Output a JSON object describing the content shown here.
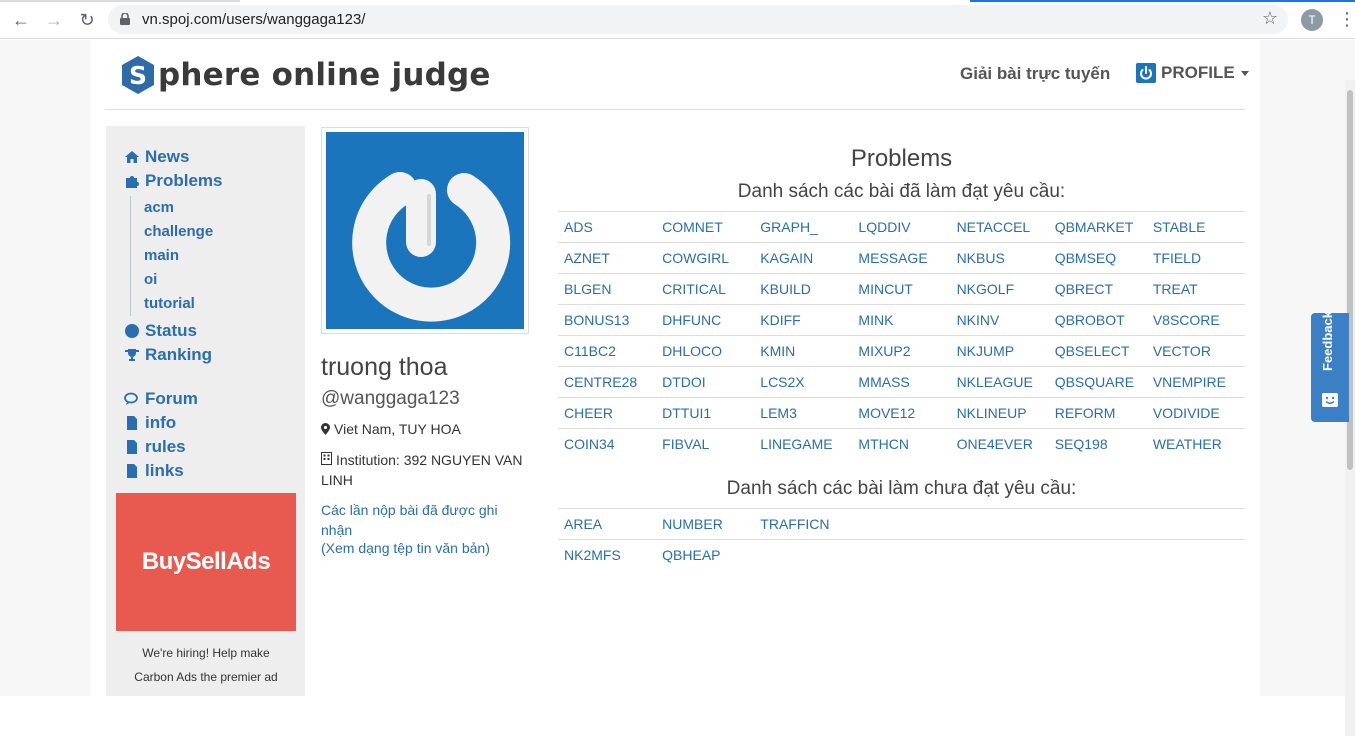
{
  "browser": {
    "url": "vn.spoj.com/users/wanggaga123/",
    "avatar_letter": "T"
  },
  "header": {
    "logo_text": "phere online judge",
    "link": "Giải bài trực tuyến",
    "profile": "PROFILE"
  },
  "sidebar": {
    "news": "News",
    "problems": "Problems",
    "sub": [
      "acm",
      "challenge",
      "main",
      "oi",
      "tutorial"
    ],
    "status": "Status",
    "ranking": "Ranking",
    "forum": "Forum",
    "info": "info",
    "rules": "rules",
    "links": "links",
    "ad_text": "BuySellAds",
    "ad_caption_1": "We're hiring! Help make",
    "ad_caption_2": "Carbon Ads the premier ad"
  },
  "profile": {
    "name": "truong thoa",
    "handle": "@wanggaga123",
    "location": "Viet Nam, TUY HOA",
    "institution": "Institution: 392 NGUYEN VAN LINH",
    "submissions_link": "Các lần nộp bài đã được ghi nhận",
    "text_link": "(Xem dạng tệp tin văn bản)"
  },
  "problems": {
    "title": "Problems",
    "solved_heading": "Danh sách các bài đã làm đạt yêu cầu:",
    "solved": [
      [
        "ADS",
        "COMNET",
        "GRAPH_",
        "LQDDIV",
        "NETACCEL",
        "QBMARKET",
        "STABLE"
      ],
      [
        "AZNET",
        "COWGIRL",
        "KAGAIN",
        "MESSAGE",
        "NKBUS",
        "QBMSEQ",
        "TFIELD"
      ],
      [
        "BLGEN",
        "CRITICAL",
        "KBUILD",
        "MINCUT",
        "NKGOLF",
        "QBRECT",
        "TREAT"
      ],
      [
        "BONUS13",
        "DHFUNC",
        "KDIFF",
        "MINK",
        "NKINV",
        "QBROBOT",
        "V8SCORE"
      ],
      [
        "C11BC2",
        "DHLOCO",
        "KMIN",
        "MIXUP2",
        "NKJUMP",
        "QBSELECT",
        "VECTOR"
      ],
      [
        "CENTRE28",
        "DTDOI",
        "LCS2X",
        "MMASS",
        "NKLEAGUE",
        "QBSQUARE",
        "VNEMPIRE"
      ],
      [
        "CHEER",
        "DTTUI1",
        "LEM3",
        "MOVE12",
        "NKLINEUP",
        "REFORM",
        "VODIVIDE"
      ],
      [
        "COIN34",
        "FIBVAL",
        "LINEGAME",
        "MTHCN",
        "ONE4EVER",
        "SEQ198",
        "WEATHER"
      ]
    ],
    "unsolved_heading": "Danh sách các bài làm chưa đạt yêu cầu:",
    "unsolved": [
      [
        "AREA",
        "NUMBER",
        "TRAFFICN",
        "",
        "",
        "",
        ""
      ],
      [
        "NK2MFS",
        "QBHEAP",
        "",
        "",
        "",
        "",
        ""
      ]
    ]
  },
  "feedback": {
    "label": "Feedback"
  },
  "colors": {
    "link": "#2a6db0",
    "brand": "#1b75bb",
    "ad": "#e85a4f"
  }
}
